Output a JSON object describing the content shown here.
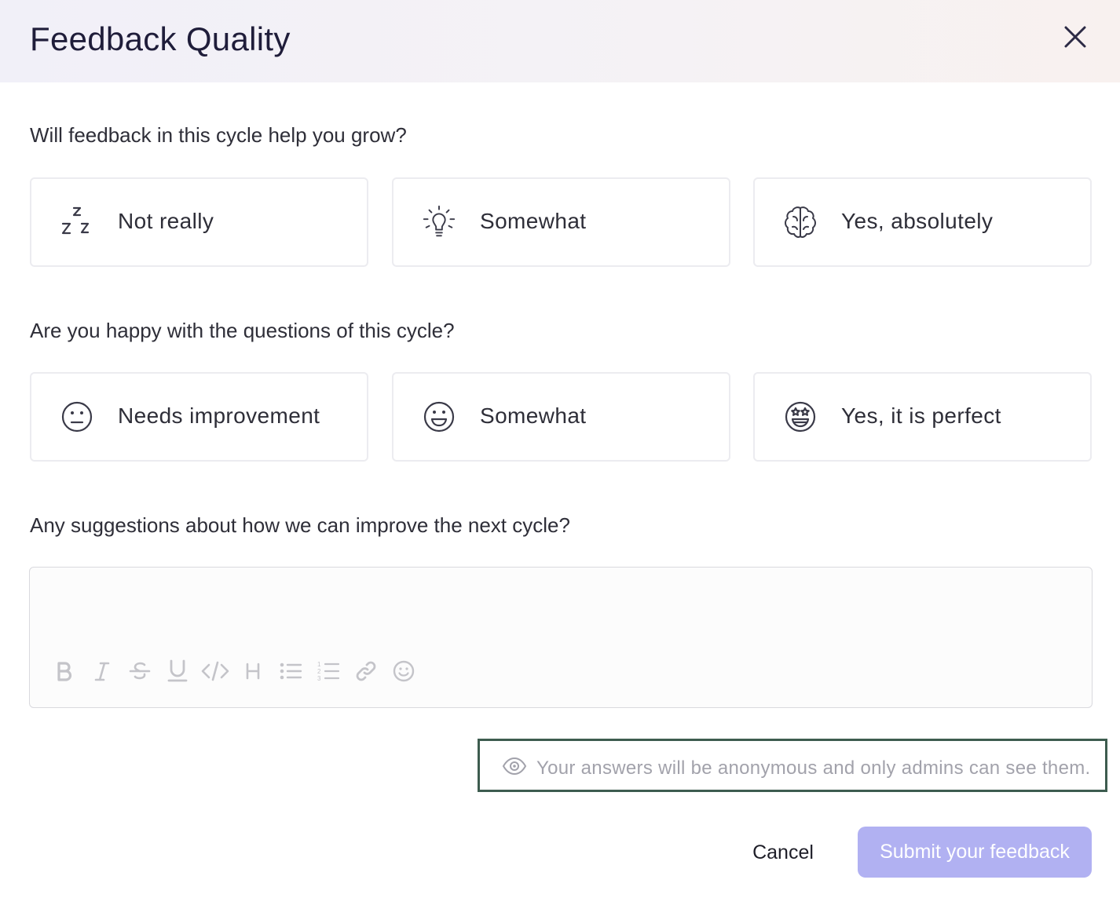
{
  "header": {
    "title": "Feedback Quality",
    "close_icon": "close-icon"
  },
  "questions": [
    {
      "text": "Will feedback in this cycle help you grow?",
      "options": [
        {
          "label": "Not really",
          "icon": "sleep-zzz-icon"
        },
        {
          "label": "Somewhat",
          "icon": "lightbulb-icon"
        },
        {
          "label": "Yes, absolutely",
          "icon": "brain-icon"
        }
      ]
    },
    {
      "text": "Are you happy with the questions of this cycle?",
      "options": [
        {
          "label": "Needs improvement",
          "icon": "neutral-face-icon"
        },
        {
          "label": "Somewhat",
          "icon": "smiling-face-icon"
        },
        {
          "label": "Yes, it is perfect",
          "icon": "star-struck-face-icon"
        }
      ]
    },
    {
      "text": "Any suggestions about how we can improve the next cycle?"
    }
  ],
  "editor": {
    "value": "",
    "toolbar": [
      "bold-icon",
      "italic-icon",
      "strikethrough-icon",
      "underline-icon",
      "code-icon",
      "heading-icon",
      "bullet-list-icon",
      "numbered-list-icon",
      "link-icon",
      "emoji-icon"
    ]
  },
  "notice": {
    "icon": "eye-icon",
    "text": "Your answers will be anonymous and only admins can see them."
  },
  "actions": {
    "cancel_label": "Cancel",
    "submit_label": "Submit your feedback"
  },
  "colors": {
    "submit_bg": "#b1b1f2",
    "notice_border": "#3d5c4f",
    "title": "#1f1d3a"
  }
}
